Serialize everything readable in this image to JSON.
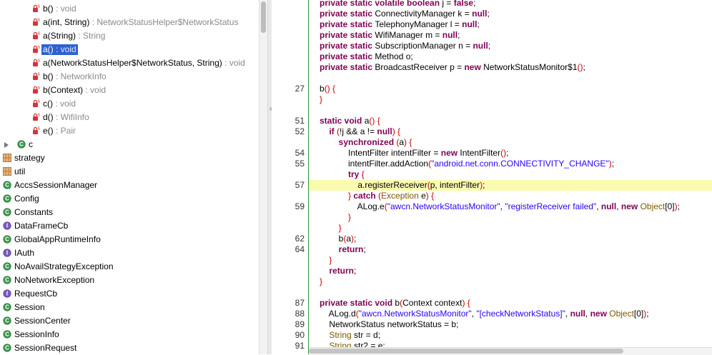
{
  "outline": {
    "items": [
      {
        "name": "b()",
        "type": " : void",
        "icon": "private-static-method",
        "indent": 2,
        "selected": false
      },
      {
        "name": "a(int, String)",
        "type": " : NetworkStatusHelper$NetworkStatus",
        "icon": "private-static-method",
        "indent": 2,
        "selected": false
      },
      {
        "name": "a(String)",
        "type": " : String",
        "icon": "private-static-method",
        "indent": 2,
        "selected": false
      },
      {
        "name": "a()",
        "type": " : void",
        "icon": "private-static-method",
        "indent": 2,
        "selected": true
      },
      {
        "name": "a(NetworkStatusHelper$NetworkStatus, String)",
        "type": " : void",
        "icon": "private-static-method",
        "indent": 2,
        "selected": false
      },
      {
        "name": "b()",
        "type": " : NetworkInfo",
        "icon": "private-static-method",
        "indent": 2,
        "selected": false
      },
      {
        "name": "b(Context)",
        "type": " : void",
        "icon": "private-static-method",
        "indent": 2,
        "selected": false
      },
      {
        "name": "c()",
        "type": " : void",
        "icon": "private-static-method",
        "indent": 2,
        "selected": false
      },
      {
        "name": "d()",
        "type": " : WifiInfo",
        "icon": "private-static-method",
        "indent": 2,
        "selected": false
      },
      {
        "name": "e()",
        "type": " : Pair",
        "icon": "private-static-method",
        "indent": 2,
        "selected": false
      },
      {
        "name": "c",
        "type": "",
        "icon": "inner-class",
        "indent": 1,
        "selected": false,
        "arrow": true
      },
      {
        "name": "strategy",
        "type": "",
        "icon": "package",
        "indent": 0,
        "selected": false
      },
      {
        "name": "util",
        "type": "",
        "icon": "package",
        "indent": 0,
        "selected": false
      },
      {
        "name": "AccsSessionManager",
        "type": "",
        "icon": "class-sync",
        "indent": 0,
        "selected": false
      },
      {
        "name": "Config",
        "type": "",
        "icon": "class",
        "indent": 0,
        "selected": false
      },
      {
        "name": "Constants",
        "type": "",
        "icon": "class",
        "indent": 0,
        "selected": false
      },
      {
        "name": "DataFrameCb",
        "type": "",
        "icon": "interface",
        "indent": 0,
        "selected": false
      },
      {
        "name": "GlobalAppRuntimeInfo",
        "type": "",
        "icon": "class",
        "indent": 0,
        "selected": false
      },
      {
        "name": "IAuth",
        "type": "",
        "icon": "interface",
        "indent": 0,
        "selected": false
      },
      {
        "name": "NoAvailStrategyException",
        "type": "",
        "icon": "class",
        "indent": 0,
        "selected": false
      },
      {
        "name": "NoNetworkException",
        "type": "",
        "icon": "class",
        "indent": 0,
        "selected": false
      },
      {
        "name": "RequestCb",
        "type": "",
        "icon": "interface",
        "indent": 0,
        "selected": false
      },
      {
        "name": "Session",
        "type": "",
        "icon": "class",
        "indent": 0,
        "selected": false
      },
      {
        "name": "SessionCenter",
        "type": "",
        "icon": "class",
        "indent": 0,
        "selected": false
      },
      {
        "name": "SessionInfo",
        "type": "",
        "icon": "class",
        "indent": 0,
        "selected": false
      },
      {
        "name": "SessionRequest",
        "type": "",
        "icon": "class",
        "indent": 0,
        "selected": false
      }
    ]
  },
  "code": {
    "lines": [
      {
        "num": "",
        "hl": false,
        "tokens": [
          {
            "t": "private static volatile boolean j = false;",
            "c": "mix"
          }
        ]
      },
      {
        "num": "",
        "hl": false,
        "tokens": [
          {
            "t": "private static ",
            "c": "kw"
          },
          {
            "t": "ConnectivityManager k = ",
            "c": ""
          },
          {
            "t": "null",
            "c": "kw"
          },
          {
            "t": ";",
            "c": ""
          }
        ]
      },
      {
        "num": "",
        "hl": false,
        "tokens": [
          {
            "t": "private static ",
            "c": "kw"
          },
          {
            "t": "TelephonyManager l = ",
            "c": ""
          },
          {
            "t": "null",
            "c": "kw"
          },
          {
            "t": ";",
            "c": ""
          }
        ]
      },
      {
        "num": "",
        "hl": false,
        "tokens": [
          {
            "t": "private static ",
            "c": "kw"
          },
          {
            "t": "WifiManager m = ",
            "c": ""
          },
          {
            "t": "null",
            "c": "kw"
          },
          {
            "t": ";",
            "c": ""
          }
        ]
      },
      {
        "num": "",
        "hl": false,
        "tokens": [
          {
            "t": "private static ",
            "c": "kw"
          },
          {
            "t": "SubscriptionManager n = ",
            "c": ""
          },
          {
            "t": "null",
            "c": "kw"
          },
          {
            "t": ";",
            "c": ""
          }
        ]
      },
      {
        "num": "",
        "hl": false,
        "tokens": [
          {
            "t": "private static ",
            "c": "kw"
          },
          {
            "t": "Method o;",
            "c": ""
          }
        ]
      },
      {
        "num": "",
        "hl": false,
        "tokens": [
          {
            "t": "private static ",
            "c": "kw"
          },
          {
            "t": "BroadcastReceiver p = ",
            "c": ""
          },
          {
            "t": "new ",
            "c": "kw"
          },
          {
            "t": "NetworkStatusMonitor$1",
            "c": ""
          },
          {
            "t": "()",
            "c": "red"
          },
          {
            "t": ";",
            "c": ""
          }
        ]
      },
      {
        "num": "",
        "hl": false,
        "tokens": []
      },
      {
        "num": "27",
        "hl": false,
        "tokens": [
          {
            "t": "b",
            "c": ""
          },
          {
            "t": "() {",
            "c": "red"
          }
        ]
      },
      {
        "num": "",
        "hl": false,
        "tokens": [
          {
            "t": "}",
            "c": "red"
          }
        ]
      },
      {
        "num": "",
        "hl": false,
        "tokens": []
      },
      {
        "num": "51",
        "hl": false,
        "tokens": [
          {
            "t": "static void ",
            "c": "kw"
          },
          {
            "t": "a",
            "c": ""
          },
          {
            "t": "() {",
            "c": "red"
          }
        ]
      },
      {
        "num": "52",
        "hl": false,
        "tokens": [
          {
            "t": "    ",
            "c": ""
          },
          {
            "t": "if ",
            "c": "kw"
          },
          {
            "t": "(",
            "c": "red"
          },
          {
            "t": "!j && a != ",
            "c": ""
          },
          {
            "t": "null",
            "c": "kw"
          },
          {
            "t": ") {",
            "c": "red"
          }
        ]
      },
      {
        "num": "",
        "hl": false,
        "tokens": [
          {
            "t": "        ",
            "c": ""
          },
          {
            "t": "synchronized ",
            "c": "kw"
          },
          {
            "t": "(",
            "c": "red"
          },
          {
            "t": "a",
            "c": ""
          },
          {
            "t": ") {",
            "c": "red"
          }
        ]
      },
      {
        "num": "54",
        "hl": false,
        "tokens": [
          {
            "t": "            IntentFilter intentFilter = ",
            "c": ""
          },
          {
            "t": "new ",
            "c": "kw"
          },
          {
            "t": "IntentFilter",
            "c": ""
          },
          {
            "t": "()",
            "c": "red"
          },
          {
            "t": ";",
            "c": ""
          }
        ]
      },
      {
        "num": "55",
        "hl": false,
        "tokens": [
          {
            "t": "            intentFilter.addAction",
            "c": ""
          },
          {
            "t": "(",
            "c": "red"
          },
          {
            "t": "\"android.net.conn.CONNECTIVITY_CHANGE\"",
            "c": "str"
          },
          {
            "t": ")",
            "c": "red"
          },
          {
            "t": ";",
            "c": ""
          }
        ]
      },
      {
        "num": "",
        "hl": false,
        "tokens": [
          {
            "t": "            ",
            "c": ""
          },
          {
            "t": "try ",
            "c": "kw"
          },
          {
            "t": "{",
            "c": "red"
          }
        ]
      },
      {
        "num": "57",
        "hl": true,
        "tokens": [
          {
            "t": "                a.registerReceiver",
            "c": ""
          },
          {
            "t": "(",
            "c": "red"
          },
          {
            "t": "p, intentFilter",
            "c": ""
          },
          {
            "t": ")",
            "c": "red"
          },
          {
            "t": ";",
            "c": ""
          }
        ]
      },
      {
        "num": "",
        "hl": false,
        "tokens": [
          {
            "t": "            ",
            "c": ""
          },
          {
            "t": "} ",
            "c": "red"
          },
          {
            "t": "catch ",
            "c": "kw"
          },
          {
            "t": "(",
            "c": "red"
          },
          {
            "t": "Exception ",
            "c": "ex"
          },
          {
            "t": "e",
            "c": ""
          },
          {
            "t": ") {",
            "c": "red"
          }
        ]
      },
      {
        "num": "59",
        "hl": false,
        "tokens": [
          {
            "t": "                ALog.e",
            "c": ""
          },
          {
            "t": "(",
            "c": "red"
          },
          {
            "t": "\"awcn.NetworkStatusMonitor\"",
            "c": "str"
          },
          {
            "t": ", ",
            "c": ""
          },
          {
            "t": "\"registerReceiver failed\"",
            "c": "str"
          },
          {
            "t": ", ",
            "c": ""
          },
          {
            "t": "null",
            "c": "kw"
          },
          {
            "t": ", ",
            "c": ""
          },
          {
            "t": "new ",
            "c": "kw"
          },
          {
            "t": "Object",
            "c": "ex"
          },
          {
            "t": "[0]",
            "c": ""
          },
          {
            "t": ")",
            "c": "red"
          },
          {
            "t": ";",
            "c": ""
          }
        ]
      },
      {
        "num": "",
        "hl": false,
        "tokens": [
          {
            "t": "            ",
            "c": ""
          },
          {
            "t": "}",
            "c": "red"
          }
        ]
      },
      {
        "num": "",
        "hl": false,
        "tokens": [
          {
            "t": "        ",
            "c": ""
          },
          {
            "t": "}",
            "c": "red"
          }
        ]
      },
      {
        "num": "62",
        "hl": false,
        "tokens": [
          {
            "t": "        b",
            "c": ""
          },
          {
            "t": "(",
            "c": "red"
          },
          {
            "t": "a",
            "c": ""
          },
          {
            "t": ")",
            "c": "red"
          },
          {
            "t": ";",
            "c": ""
          }
        ]
      },
      {
        "num": "64",
        "hl": false,
        "tokens": [
          {
            "t": "        ",
            "c": ""
          },
          {
            "t": "return",
            "c": "kw"
          },
          {
            "t": ";",
            "c": ""
          }
        ]
      },
      {
        "num": "",
        "hl": false,
        "tokens": [
          {
            "t": "    ",
            "c": ""
          },
          {
            "t": "}",
            "c": "red"
          }
        ]
      },
      {
        "num": "",
        "hl": false,
        "tokens": [
          {
            "t": "    ",
            "c": ""
          },
          {
            "t": "return",
            "c": "kw"
          },
          {
            "t": ";",
            "c": ""
          }
        ]
      },
      {
        "num": "",
        "hl": false,
        "tokens": [
          {
            "t": "}",
            "c": "red"
          }
        ]
      },
      {
        "num": "",
        "hl": false,
        "tokens": []
      },
      {
        "num": "87",
        "hl": false,
        "tokens": [
          {
            "t": "private static void ",
            "c": "kw"
          },
          {
            "t": "b",
            "c": ""
          },
          {
            "t": "(",
            "c": "red"
          },
          {
            "t": "Context context",
            "c": ""
          },
          {
            "t": ") {",
            "c": "red"
          }
        ]
      },
      {
        "num": "88",
        "hl": false,
        "tokens": [
          {
            "t": "    ALog.d",
            "c": ""
          },
          {
            "t": "(",
            "c": "red"
          },
          {
            "t": "\"awcn.NetworkStatusMonitor\"",
            "c": "str"
          },
          {
            "t": ", ",
            "c": ""
          },
          {
            "t": "\"[checkNetworkStatus]\"",
            "c": "str"
          },
          {
            "t": ", ",
            "c": ""
          },
          {
            "t": "null",
            "c": "kw"
          },
          {
            "t": ", ",
            "c": ""
          },
          {
            "t": "new ",
            "c": "kw"
          },
          {
            "t": "Object",
            "c": "ex"
          },
          {
            "t": "[0]",
            "c": ""
          },
          {
            "t": ")",
            "c": "red"
          },
          {
            "t": ";",
            "c": ""
          }
        ]
      },
      {
        "num": "89",
        "hl": false,
        "tokens": [
          {
            "t": "    NetworkStatus networkStatus = b;",
            "c": ""
          }
        ]
      },
      {
        "num": "90",
        "hl": false,
        "tokens": [
          {
            "t": "    ",
            "c": ""
          },
          {
            "t": "String ",
            "c": "ex"
          },
          {
            "t": "str = d;",
            "c": ""
          }
        ]
      },
      {
        "num": "91",
        "hl": false,
        "tokens": [
          {
            "t": "    ",
            "c": ""
          },
          {
            "t": "String ",
            "c": "ex"
          },
          {
            "t": "str2 = e;",
            "c": ""
          }
        ]
      }
    ]
  }
}
